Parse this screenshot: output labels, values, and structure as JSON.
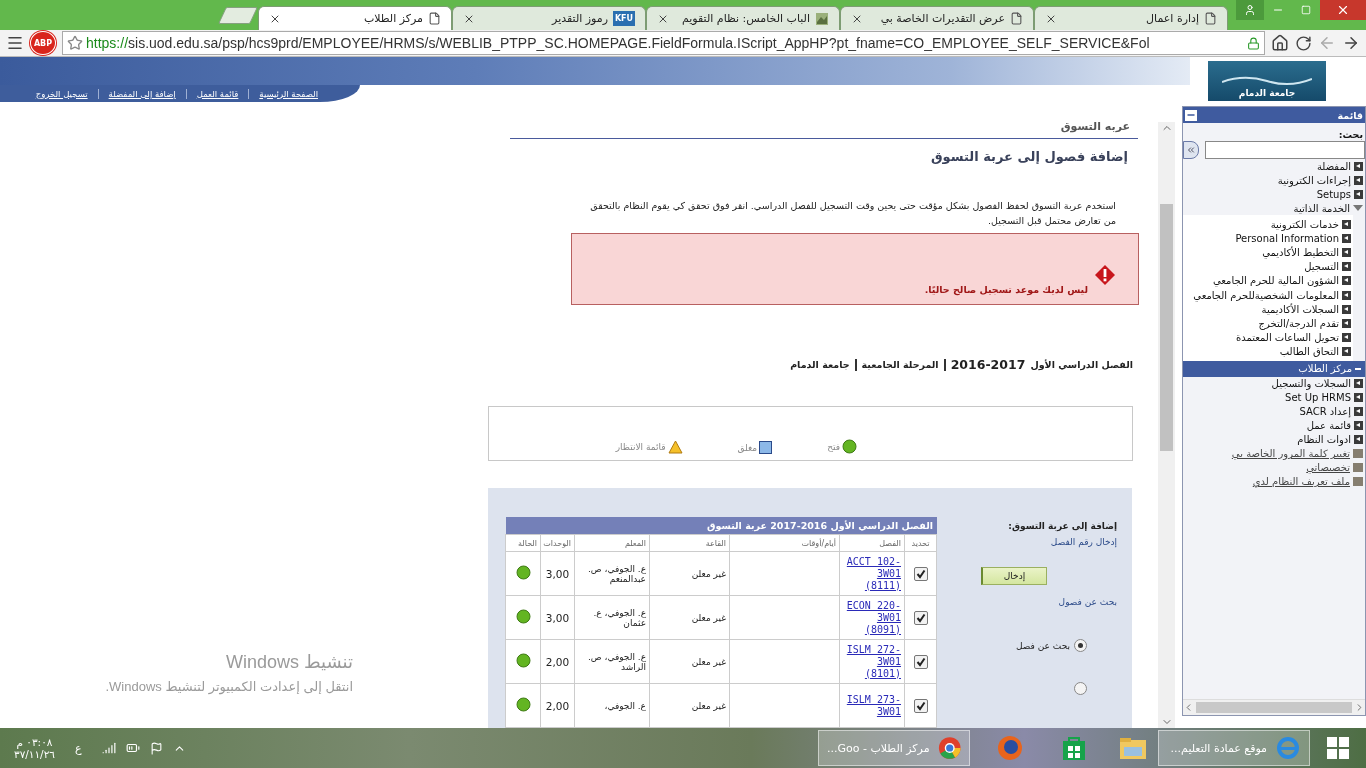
{
  "browser": {
    "tabs": [
      {
        "title": "إدارة اعمال",
        "kind": "page",
        "selected": false
      },
      {
        "title": "عرض التقديرات الخاصة بي",
        "kind": "page",
        "selected": false
      },
      {
        "title": "الباب الخامس: نظام التقويم",
        "kind": "image",
        "selected": false
      },
      {
        "title": "رموز التقدير",
        "kind": "badge",
        "badge": "KFU",
        "selected": false
      },
      {
        "title": "مركز الطلاب",
        "kind": "page",
        "selected": true
      }
    ],
    "adblock": "ABP",
    "url_scheme": "https://",
    "url_rest": "sis.uod.edu.sa/psp/hcs9prd/EMPLOYEE/HRMS/s/WEBLIB_PTPP_SC.HOMEPAGE.FieldFormula.IScript_AppHP?pt_fname=CO_EMPLOYEE_SELF_SERVICE&Fol"
  },
  "header": {
    "links": [
      "الصفحة الرئيسية",
      "قائمة العمل",
      "إضافة إلى المفضلة",
      "تسجيل الخروج"
    ],
    "logo_text": "جامعة الدمام"
  },
  "page": {
    "title": "عربه التسوق",
    "heading": "إضافة فصول إلى عربة التسوق",
    "intro": "استخدم عربة التسوق لحفظ الفصول بشكل مؤقت حتى يحين وقت التسجيل للفصل الدراسي.  انقر فوق تحقق كي يقوم النظام بالتحقق من تعارض محتمل قبل التسجيل.",
    "error": "ليس لديك موعد تسجيل صالح حاليًا.",
    "term": {
      "name": "الفصل الدراسي الأول",
      "year": "2016-2017",
      "career": "المرحلة الجامعية",
      "institution": "جامعة الدمام"
    },
    "legend": [
      {
        "label": "فتح",
        "kind": "open"
      },
      {
        "label": "مغلق",
        "kind": "closed"
      },
      {
        "label": "قائمة الانتظار",
        "kind": "waitlist"
      }
    ],
    "cart": {
      "title": "الفصل الدراسي الأول 2016-2017 عربة التسوق",
      "columns": [
        "تحديد",
        "الفصل",
        "أيام/أوقات",
        "القاعة",
        "المعلم",
        "الوحدات",
        "الحالة"
      ],
      "rows": [
        {
          "checked": true,
          "course": "ACCT 102-3W01 (8111)",
          "room": "غير معلن",
          "instructor": "ع. الجوفي، ص. عبدالمنعم",
          "units": "3,00",
          "kind": "open"
        },
        {
          "checked": true,
          "course": "ECON 220-3W01 (8091)",
          "room": "غير معلن",
          "instructor": "ع. الجوفي، ع. عثمان",
          "units": "3,00",
          "kind": "open"
        },
        {
          "checked": true,
          "course": "ISLM 272-3W01 (8101)",
          "room": "غير معلن",
          "instructor": "ع. الجوفي، ص. الراشد",
          "units": "2,00",
          "kind": "open"
        },
        {
          "checked": true,
          "course": "ISLM 273-3W01",
          "room": "غير معلن",
          "instructor": "ع. الجوفي،",
          "units": "2,00",
          "kind": "open"
        }
      ],
      "add_label": "إضافة إلى عربة التسوق:",
      "enter_label": "إدخال رقم الفصل",
      "enter_button": "إدخال",
      "search_label": "بحث عن فصول",
      "radios": [
        {
          "label": "بحث عن فصل",
          "selected": true
        },
        {
          "selected": false
        }
      ]
    }
  },
  "menu": {
    "title": "قائمة",
    "search_label": "بحث:",
    "items": [
      {
        "label": "المفضلة",
        "kind": "folder",
        "expanded": false,
        "selected": false
      },
      {
        "label": "إجراءات الكترونية",
        "kind": "folder",
        "expanded": false,
        "selected": false
      },
      {
        "label": "Setups",
        "kind": "folder",
        "expanded": false,
        "selected": false
      },
      {
        "label": "الخدمة الذاتية",
        "kind": "folder",
        "expanded": true,
        "selected": false,
        "children": [
          {
            "label": "خدمات الكترونية",
            "kind": "folder",
            "expanded": false,
            "selected": false
          },
          {
            "label": "Personal Information",
            "kind": "folder",
            "expanded": false,
            "selected": false
          },
          {
            "label": "التخطيط الأكاديمي",
            "kind": "folder",
            "expanded": false,
            "selected": false
          },
          {
            "label": "التسجيل",
            "kind": "folder",
            "expanded": false,
            "selected": false
          },
          {
            "label": "الشؤون المالية للحرم الجامعي",
            "kind": "folder",
            "expanded": false,
            "selected": false
          },
          {
            "label": "المعلومات الشخصيةللحرم الجامعي",
            "kind": "folder",
            "expanded": false,
            "selected": false
          },
          {
            "label": "السجلات الأكاديمية",
            "kind": "folder",
            "expanded": false,
            "selected": false
          },
          {
            "label": "تقدم الدرجة/التخرج",
            "kind": "folder",
            "expanded": false,
            "selected": false
          },
          {
            "label": "تحويل الساعات المعتمدة",
            "kind": "folder",
            "expanded": false,
            "selected": false
          },
          {
            "label": "التحاق الطالب",
            "kind": "folder",
            "expanded": false,
            "selected": false
          }
        ]
      },
      {
        "label": "مركز الطلاب",
        "kind": "page",
        "selected": true
      },
      {
        "label": "السجلات والتسجيل",
        "kind": "folder",
        "expanded": false,
        "selected": false
      },
      {
        "label": "Set Up HRMS",
        "kind": "folder",
        "expanded": false,
        "selected": false
      },
      {
        "label": "إعداد SACR",
        "kind": "folder",
        "expanded": false,
        "selected": false
      },
      {
        "label": "قائمة عمل",
        "kind": "folder",
        "expanded": false,
        "selected": false
      },
      {
        "label": "ادوات النظام",
        "kind": "folder",
        "expanded": false,
        "selected": false
      },
      {
        "label": "تغيير كلمة المرور الخاصة بي",
        "kind": "link",
        "selected": false
      },
      {
        "label": "تخصيصاتي",
        "kind": "link",
        "selected": false
      },
      {
        "label": "ملف تعريف النظام لدي",
        "kind": "link",
        "selected": false
      }
    ]
  },
  "os_notice": {
    "title": "تنشيط Windows",
    "text": "انتقل إلى إعدادت الكمبيوتر لتنشيط Windows."
  },
  "taskbar": {
    "apps": [
      {
        "kind": "ie",
        "label": "موقع عمادة التعليم..."
      },
      {
        "kind": "explorer"
      },
      {
        "kind": "store"
      },
      {
        "kind": "firefox"
      },
      {
        "kind": "chrome",
        "label": "مركز الطلاب - Goo..."
      }
    ],
    "language": "ع",
    "time": "٠٣:٠٨ م",
    "date": "٣٧/١١/٢٦"
  }
}
